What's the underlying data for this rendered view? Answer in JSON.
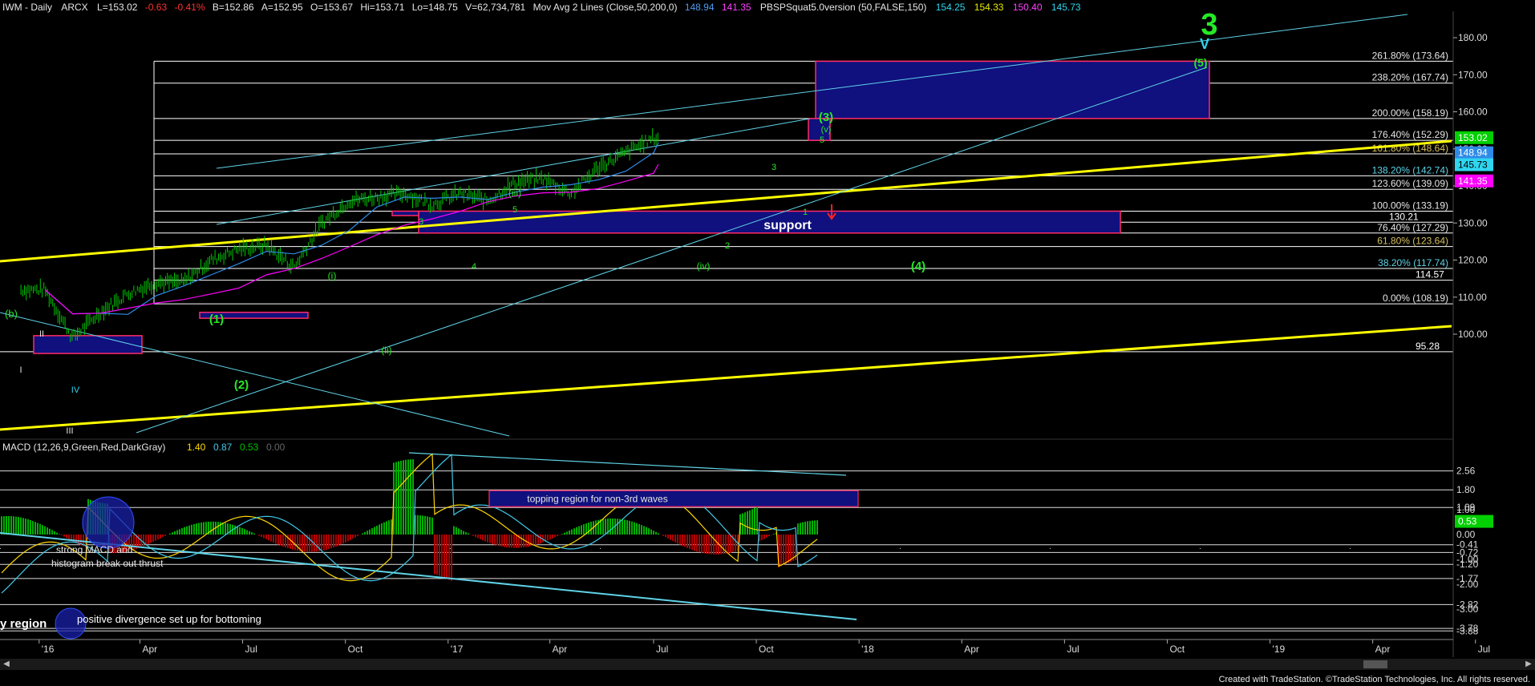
{
  "header": {
    "symbol": "IWM - Daily",
    "exchange": "ARCX",
    "last": "L=153.02",
    "change": "-0.63",
    "change_pct": "-0.41%",
    "bid": "B=152.86",
    "ask": "A=152.95",
    "open": "O=153.67",
    "high": "Hi=153.71",
    "low": "Lo=148.75",
    "volume": "V=62,734,781",
    "ma_label": "Mov Avg 2 Lines (Close,50,200,0)",
    "ma50": "148.94",
    "ma200": "141.35",
    "pbs_label": "PBSPSquat5.0version (50,FALSE,150)",
    "pbs_values": [
      "154.25",
      "154.33",
      "150.40",
      "145.73"
    ]
  },
  "colors": {
    "background": "#000000",
    "price_bars": "#00c800",
    "fib_lines": "#ffffff",
    "trendline_yellow": "#ffff00",
    "channel_cyan": "#5fd3e6",
    "ma_blue": "#2e8be8",
    "ma_magenta": "#ff00ff",
    "box_fill": "#10107e",
    "box_border": "#ff2a66",
    "wave_green": "#27e827",
    "wave_cyan": "#2fd6f0",
    "macd_yellow": "#ffd700",
    "macd_cyan": "#40c8e8",
    "hist_green": "#00b000",
    "hist_red": "#b00000"
  },
  "chart_data": [
    {
      "type": "line",
      "title": "IWM - Daily",
      "x": [
        "2016-01",
        "2016-02",
        "2016-03",
        "2016-04",
        "2016-05",
        "2016-06",
        "2016-07",
        "2016-08",
        "2016-09",
        "2016-10",
        "2016-11",
        "2016-12",
        "2017-01",
        "2017-02",
        "2017-03",
        "2017-04",
        "2017-05",
        "2017-06",
        "2017-07",
        "2017-08",
        "2017-09",
        "2017-10",
        "2017-11"
      ],
      "x_tick_labels": [
        "'16",
        "Apr",
        "Jul",
        "Oct",
        "'17",
        "Apr",
        "Jul",
        "Oct",
        "'18",
        "Apr",
        "Jul",
        "Oct",
        "'19",
        "Apr",
        "Jul"
      ],
      "series": [
        {
          "values": [
            112,
            99,
            106,
            111,
            114,
            114,
            120,
            123,
            124,
            118,
            130,
            136,
            137,
            138,
            135,
            138,
            136,
            141,
            142,
            138,
            145,
            149,
            153
          ]
        }
      ],
      "y_tick_labels": [
        "100.00",
        "110.00",
        "120.00",
        "130.00",
        "140.00",
        "150.00",
        "160.00",
        "170.00",
        "180.00"
      ],
      "ylim": [
        93,
        186
      ],
      "last_price": 153.02,
      "right_axis_tags": [
        {
          "label": "153.02",
          "value": 153.02,
          "color": "#00d000",
          "text": "#ffffff"
        },
        {
          "label": "148.94",
          "value": 148.94,
          "color": "#2e8be8",
          "text": "#ffffff"
        },
        {
          "label": "145.73",
          "value": 145.73,
          "color": "#2fd6f0",
          "text": "#000000"
        },
        {
          "label": "141.35",
          "value": 141.35,
          "color": "#ff00ff",
          "text": "#ffffff"
        }
      ],
      "extra_levels": [
        {
          "label": "130.21",
          "value": 130.21
        },
        {
          "label": "114.57",
          "value": 114.57
        },
        {
          "label": "95.28",
          "value": 95.28
        }
      ],
      "fib_levels": [
        {
          "label": "261.80% (173.64)",
          "value": 173.64
        },
        {
          "label": "238.20% (167.74)",
          "value": 167.74
        },
        {
          "label": "200.00% (158.19)",
          "value": 158.19
        },
        {
          "label": "176.40% (152.29)",
          "value": 152.29
        },
        {
          "label": "161.80% (148.64)",
          "value": 148.64
        },
        {
          "label": "138.20% (142.74)",
          "value": 142.74
        },
        {
          "label": "123.60% (139.09)",
          "value": 139.09
        },
        {
          "label": "100.00% (133.19)",
          "value": 133.19
        },
        {
          "label": "76.40% (127.29)",
          "value": 127.29
        },
        {
          "label": "61.80% (123.64)",
          "value": 123.64
        },
        {
          "label": "38.20% (117.74)",
          "value": 117.74
        },
        {
          "label": "0.00% (108.19)",
          "value": 108.19
        }
      ],
      "annotations": [
        {
          "text": "support",
          "kind": "box-label"
        },
        {
          "text": "(4)",
          "kind": "wave"
        },
        {
          "text": "(5)",
          "kind": "wave"
        },
        {
          "text": "(3)",
          "kind": "wave"
        },
        {
          "text": "(v)",
          "kind": "wave"
        },
        {
          "text": "(iv)",
          "kind": "wave"
        },
        {
          "text": "(iii)",
          "kind": "wave"
        },
        {
          "text": "(ii)",
          "kind": "wave"
        },
        {
          "text": "(i)",
          "kind": "wave"
        },
        {
          "text": "(2)",
          "kind": "wave"
        },
        {
          "text": "(1)",
          "kind": "wave"
        },
        {
          "text": "(b)",
          "kind": "wave"
        },
        {
          "text": "3",
          "kind": "big"
        },
        {
          "text": "V",
          "kind": "big"
        },
        {
          "text": "3",
          "kind": "minor"
        },
        {
          "text": "4",
          "kind": "minor"
        },
        {
          "text": "5",
          "kind": "minor"
        },
        {
          "text": "1",
          "kind": "minor"
        },
        {
          "text": "2",
          "kind": "minor"
        },
        {
          "text": "I",
          "kind": "roman"
        },
        {
          "text": "II",
          "kind": "roman"
        },
        {
          "text": "III",
          "kind": "roman"
        },
        {
          "text": "IV",
          "kind": "roman"
        }
      ]
    },
    {
      "type": "line",
      "title": "MACD (12,26,9,Green,Red,DarkGray)",
      "readings": [
        "1.40",
        "0.87",
        "0.53",
        "0.00"
      ],
      "y_tick_labels": [
        "2.56",
        "1.80",
        "1.09",
        "1.00",
        "0.53",
        "0.00",
        "-0.41",
        "-0.72",
        "-1.00",
        "-1.20",
        "-1.77",
        "-2.00",
        "-2.82",
        "-3.00",
        "-3.78",
        "-3.88"
      ],
      "ylim": [
        -3.9,
        3.4
      ],
      "annotations": [
        {
          "text": "topping region for non-3rd waves"
        },
        {
          "text": "strong MACD  and"
        },
        {
          "text": "histogram break out thrust"
        },
        {
          "text": "positive divergence set up for bottoming"
        },
        {
          "text": "y region"
        }
      ]
    }
  ],
  "footer": "Created with TradeStation. ©TradeStation Technologies, Inc. All rights reserved."
}
